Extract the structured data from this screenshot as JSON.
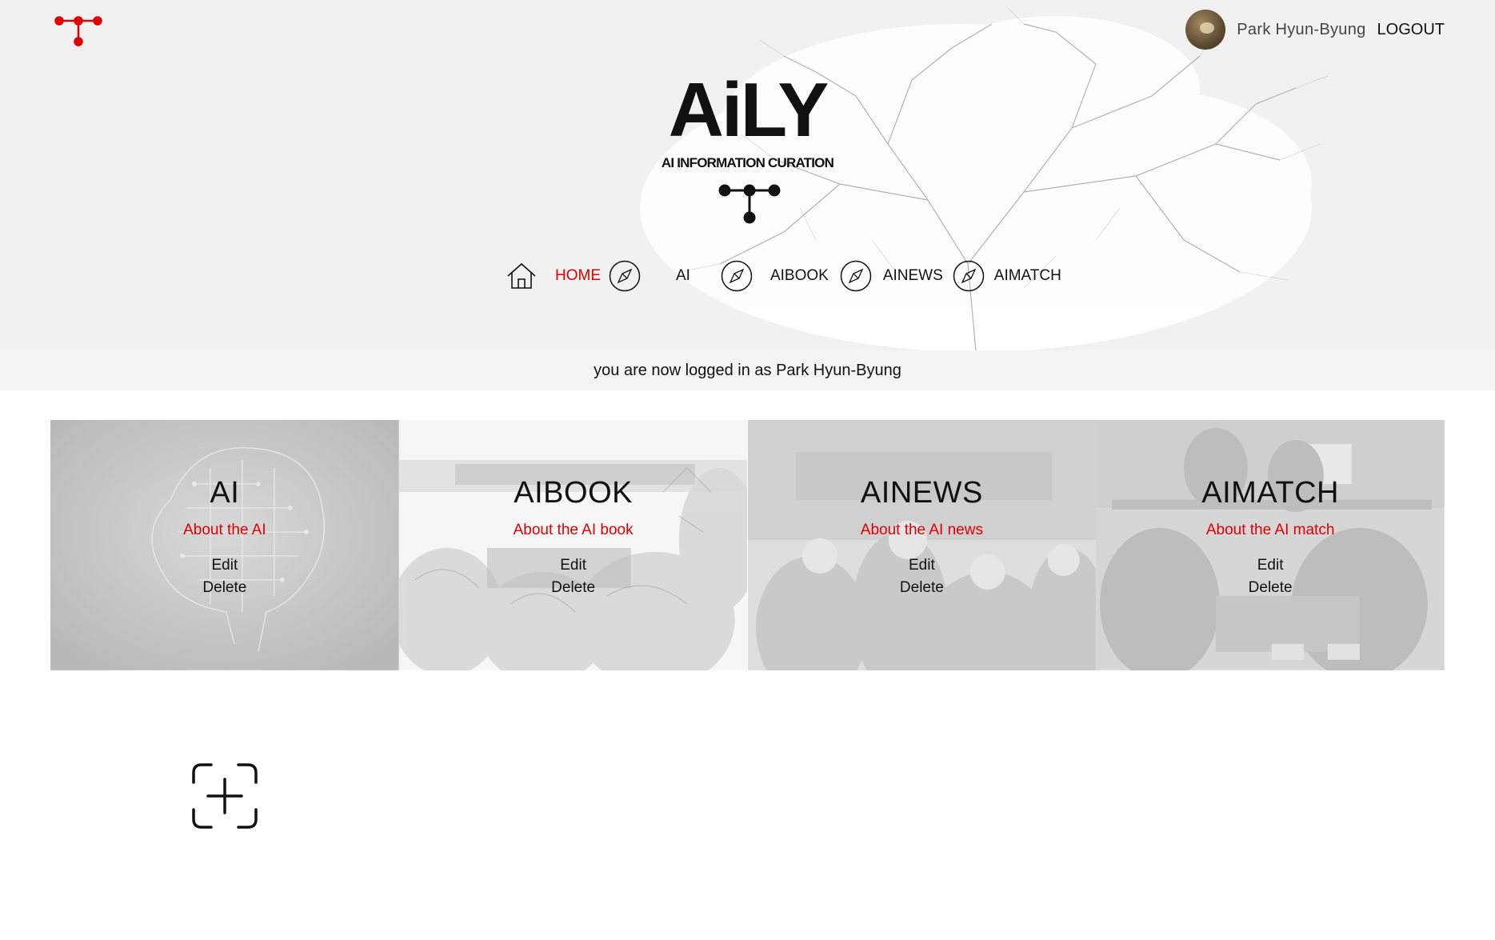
{
  "header": {
    "logo_icon": "tree-node-logo-icon",
    "accent_color": "#e00000",
    "user_name": "Park Hyun-Byung",
    "logout_label": "LOGOUT"
  },
  "brand": {
    "title": "AiLY",
    "subtitle": "AI INFORMATION CURATION"
  },
  "nav": {
    "home_label": "HOME",
    "items": [
      {
        "label": "AI",
        "icon": "compass-icon"
      },
      {
        "label": "AIBOOK",
        "icon": "compass-icon"
      },
      {
        "label": "AINEWS",
        "icon": "compass-icon"
      },
      {
        "label": "AIMATCH",
        "icon": "compass-icon"
      }
    ]
  },
  "status_message": "you are now logged in as Park Hyun-Byung",
  "cards": [
    {
      "title": "AI",
      "description": "About the AI",
      "edit": "Edit",
      "delete": "Delete"
    },
    {
      "title": "AIBOOK",
      "description": "About the AI book",
      "edit": "Edit",
      "delete": "Delete"
    },
    {
      "title": "AINEWS",
      "description": "About the AI news",
      "edit": "Edit",
      "delete": "Delete"
    },
    {
      "title": "AIMATCH",
      "description": "About the AI match",
      "edit": "Edit",
      "delete": "Delete"
    }
  ],
  "add_button_icon": "add-frame-icon"
}
